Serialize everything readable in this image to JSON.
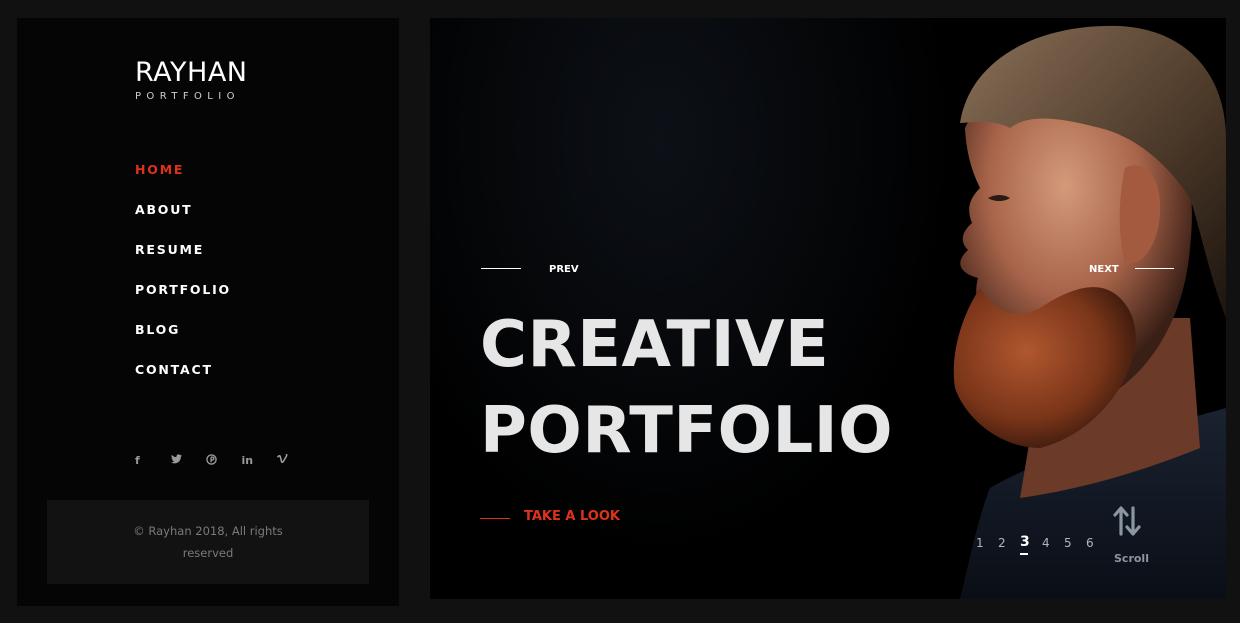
{
  "sidebar": {
    "logo": {
      "name": "RAYHAN",
      "subtitle": "PORTFOLIO"
    },
    "nav": [
      {
        "label": "HOME",
        "active": true
      },
      {
        "label": "ABOUT",
        "active": false
      },
      {
        "label": "RESUME",
        "active": false
      },
      {
        "label": "PORTFOLIO",
        "active": false
      },
      {
        "label": "BLOG",
        "active": false
      },
      {
        "label": "CONTACT",
        "active": false
      }
    ],
    "social": [
      {
        "icon": "facebook-icon",
        "glyph": "f"
      },
      {
        "icon": "twitter-icon",
        "glyph": "🐦"
      },
      {
        "icon": "pinterest-icon",
        "glyph": "℗"
      },
      {
        "icon": "linkedin-icon",
        "glyph": "in"
      },
      {
        "icon": "vimeo-icon",
        "glyph": "v"
      }
    ],
    "copyright": "© Rayhan 2018, All rights reserved"
  },
  "hero": {
    "prev_label": "PREV",
    "next_label": "NEXT",
    "headline_line1": "CREATIVE",
    "headline_line2": "PORTFOLIO",
    "cta_label": "TAKE A LOOK",
    "pages": [
      "1",
      "2",
      "3",
      "4",
      "5",
      "6"
    ],
    "active_page": "3",
    "scroll_label": "Scroll"
  },
  "colors": {
    "accent": "#e0321b",
    "sidebar_bg": "#050505",
    "page_bg": "#111111"
  }
}
